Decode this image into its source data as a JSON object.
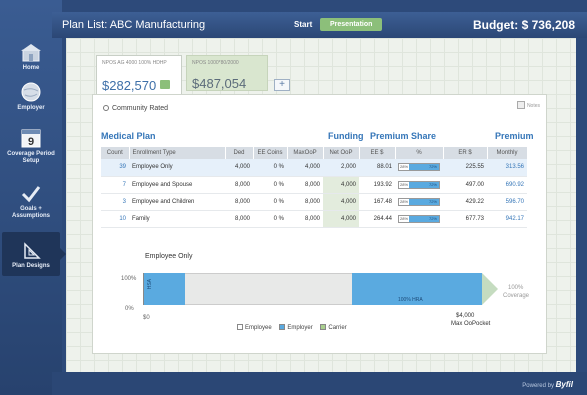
{
  "topbar": {
    "title": "Plan List: ABC Manufacturing",
    "start_label": "Start",
    "presentation_label": "Presentation",
    "budget": "Budget: $ 736,208"
  },
  "sidebar": {
    "items": [
      {
        "label": "Home",
        "icon": "home-icon"
      },
      {
        "label": "Employer",
        "icon": "employer-globe-icon"
      },
      {
        "label": "Coverage Period Setup",
        "icon": "calendar-icon",
        "icon_text": "9"
      },
      {
        "label": "Goals + Assumptions",
        "icon": "checkmark-icon"
      },
      {
        "label": "Plan Designs",
        "icon": "plan-design-icon",
        "active": true
      }
    ]
  },
  "plan_tabs": [
    {
      "caption": "NPOS AG 4000 100% HDHP",
      "amount": "$282,570"
    },
    {
      "caption": "NPOS 1000*80/2000",
      "amount": "$487,054"
    }
  ],
  "add_tab_label": "+",
  "panel": {
    "community_rated": "Community Rated",
    "notes": "Notes",
    "medical_plan": "Medical Plan",
    "funding": "Funding",
    "premium_share": "Premium Share",
    "premium": "Premium",
    "columns": [
      "Count",
      "Enrollment Type",
      "Ded",
      "EE Coins",
      "MaxOoP",
      "Net OoP",
      "EE $",
      "%",
      "ER $",
      "Monthly"
    ],
    "rows": [
      {
        "count": "39",
        "type": "Employee Only",
        "ded": "4,000",
        "coins": "0 %",
        "maxoop": "4,000",
        "netoop": "2,000",
        "ee": "88.01",
        "ee_pct": "28%",
        "er_pct": "72%",
        "er": "225.55",
        "monthly": "313.56"
      },
      {
        "count": "7",
        "type": "Employee and Spouse",
        "ded": "8,000",
        "coins": "0 %",
        "maxoop": "8,000",
        "netoop": "4,000",
        "ee": "193.92",
        "ee_pct": "28%",
        "er_pct": "72%",
        "er": "497.00",
        "monthly": "690.92"
      },
      {
        "count": "3",
        "type": "Employee and Children",
        "ded": "8,000",
        "coins": "0 %",
        "maxoop": "8,000",
        "netoop": "4,000",
        "ee": "167.48",
        "ee_pct": "28%",
        "er_pct": "72%",
        "er": "429.22",
        "monthly": "596.70"
      },
      {
        "count": "10",
        "type": "Family",
        "ded": "8,000",
        "coins": "0 %",
        "maxoop": "8,000",
        "netoop": "4,000",
        "ee": "264.44",
        "ee_pct": "28%",
        "er_pct": "72%",
        "er": "677.73",
        "monthly": "942.17"
      }
    ]
  },
  "chart": {
    "title": "Employee Only",
    "y_top": "100%",
    "y_bottom": "0%",
    "x_start": "$0",
    "hsa_label": "HSA",
    "hra_label": "100% HRA",
    "end_label_1": "100%",
    "end_label_2": "Coverage",
    "max_amount": "$4,000",
    "max_label": "Max OoPocket",
    "legend": [
      {
        "label": "Employee",
        "color": "#ffffff"
      },
      {
        "label": "Employer",
        "color": "#5aaae0"
      },
      {
        "label": "Carrier",
        "color": "#a9cf8e"
      }
    ]
  },
  "footer": {
    "powered_by": "Powered by",
    "brand": "Byfil"
  }
}
